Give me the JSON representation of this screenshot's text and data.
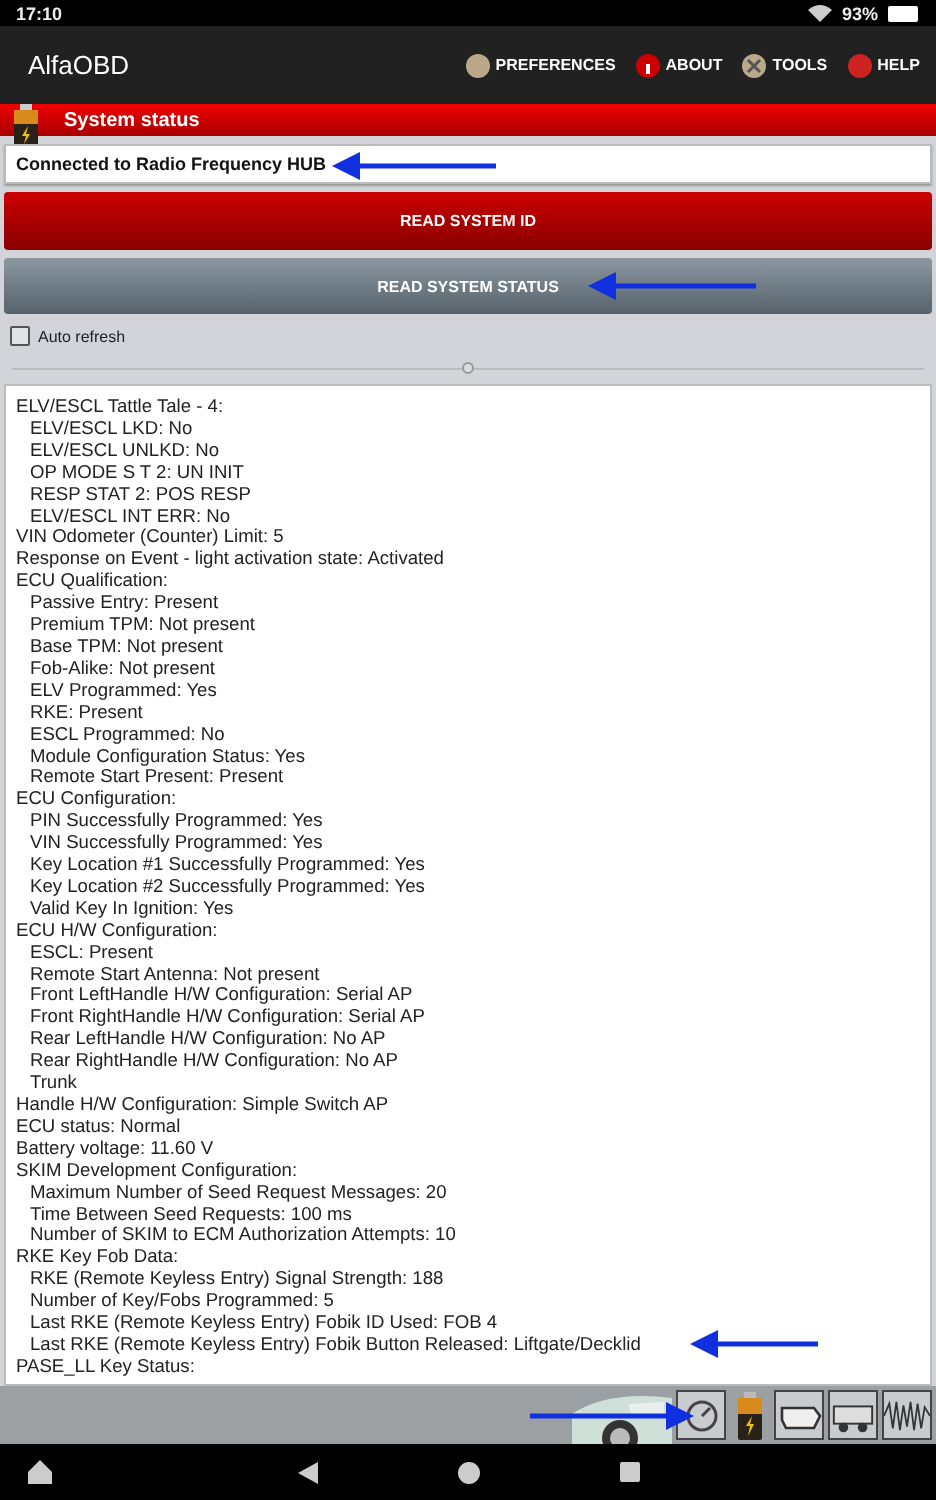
{
  "status_bar": {
    "time": "17:10",
    "battery": "93%"
  },
  "app_bar": {
    "title": "AlfaOBD",
    "menu": [
      "PREFERENCES",
      "ABOUT",
      "TOOLS",
      "HELP"
    ]
  },
  "header": {
    "title": "System status"
  },
  "connection": {
    "value": "Connected to Radio Frequency HUB"
  },
  "buttons": [
    {
      "label": "READ SYSTEM ID",
      "kind": "primary"
    },
    {
      "label": "READ SYSTEM STATUS",
      "kind": "secondary"
    }
  ],
  "auto_refresh": {
    "label": "Auto refresh",
    "checked": false
  },
  "report": [
    {
      "text": "ELV/ESCL Tattle Tale - 4:",
      "children": [
        {
          "text": "ELV/ESCL LKD: No"
        },
        {
          "text": "ELV/ESCL UNLKD: No"
        },
        {
          "text": "OP MODE S T 2: UN INIT"
        },
        {
          "text": "RESP STAT 2: POS RESP"
        },
        {
          "text": "ELV/ESCL INT ERR: No"
        }
      ]
    },
    {
      "text": "VIN Odometer (Counter) Limit: 5"
    },
    {
      "text": "Response on Event - light activation state: Activated"
    },
    {
      "text": "ECU Qualification:",
      "children": [
        {
          "text": "Passive Entry: Present"
        },
        {
          "text": "Premium TPM: Not present"
        },
        {
          "text": "Base TPM: Not present"
        },
        {
          "text": "Fob-Alike: Not present"
        },
        {
          "text": "ELV Programmed: Yes"
        },
        {
          "text": "RKE: Present"
        },
        {
          "text": "ESCL Programmed: No"
        },
        {
          "text": "Module Configuration Status: Yes"
        },
        {
          "text": "Remote Start Present: Present"
        }
      ]
    },
    {
      "text": "ECU Configuration:",
      "children": [
        {
          "text": "PIN Successfully Programmed: Yes"
        },
        {
          "text": "VIN Successfully Programmed: Yes"
        },
        {
          "text": "Key Location #1 Successfully Programmed: Yes"
        },
        {
          "text": "Key Location #2 Successfully Programmed: Yes"
        },
        {
          "text": "Valid Key In Ignition: Yes"
        }
      ]
    },
    {
      "text": "ECU H/W Configuration:",
      "children": [
        {
          "text": "ESCL: Present"
        },
        {
          "text": "Remote Start Antenna: Not present"
        },
        {
          "text": "Front LeftHandle H/W Configuration: Serial AP"
        },
        {
          "text": "Front RightHandle H/W Configuration: Serial AP"
        },
        {
          "text": "Rear LeftHandle H/W Configuration: No AP"
        },
        {
          "text": "Rear RightHandle H/W Configuration: No AP"
        },
        {
          "text": "Trunk"
        }
      ]
    },
    {
      "text": "Handle H/W Configuration: Simple Switch AP"
    },
    {
      "text": "ECU status: Normal"
    },
    {
      "text": "Battery voltage: 11.60 V"
    },
    {
      "text": "SKIM Development Configuration:",
      "children": [
        {
          "text": "Maximum Number of Seed Request Messages: 20"
        },
        {
          "text": "Time Between Seed Requests: 100 ms"
        },
        {
          "text": "Number of SKIM to ECM Authorization Attempts: 10"
        }
      ]
    },
    {
      "text": "RKE Key Fob Data:",
      "children": [
        {
          "text": "RKE (Remote Keyless Entry) Signal Strength: 188"
        },
        {
          "text": "Number of Key/Fobs Programmed: 5"
        },
        {
          "text": "Last RKE (Remote Keyless Entry) Fobik ID Used: FOB 4"
        },
        {
          "text": "Last RKE (Remote Keyless Entry) Fobik Button Released: Liftgate/Decklid"
        }
      ]
    },
    {
      "text": "PASE_LL Key Status:"
    }
  ]
}
